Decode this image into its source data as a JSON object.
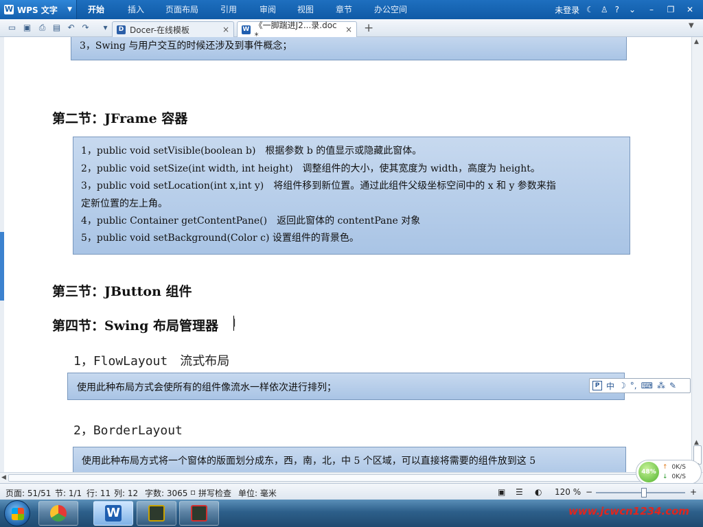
{
  "app": {
    "name": "WPS 文字",
    "menu": [
      "开始",
      "插入",
      "页面布局",
      "引用",
      "审阅",
      "视图",
      "章节",
      "办公空间"
    ],
    "login": "未登录",
    "help": "?"
  },
  "tabs": [
    {
      "label": "Docer-在线模板",
      "icon": "docer-icon",
      "close": "×"
    },
    {
      "label": "《一脚踹进J2...录.doc *",
      "icon": "wps-doc-icon",
      "close": "×"
    }
  ],
  "document": {
    "top_box_line": "3，Swing 与用户交互的时候还涉及到事件概念；",
    "section2": {
      "heading": "第二节：JFrame 容器",
      "items": [
        "1，public void setVisible(boolean b)　根据参数 b 的值显示或隐藏此窗体。",
        "2，public void setSize(int width, int height)　调整组件的大小，使其宽度为 width，高度为 height。",
        "3，public void setLocation(int x,int y)　将组件移到新位置。通过此组件父级坐标空间中的 x 和 y 参数来指",
        "定新位置的左上角。",
        "4，public Container getContentPane()　返回此窗体的 contentPane 对象",
        "5，public void setBackground(Color c) 设置组件的背景色。"
      ]
    },
    "section3": {
      "heading": "第三节：JButton 组件"
    },
    "section4": {
      "heading": "第四节：Swing 布局管理器",
      "layout1": {
        "title": "1，FlowLayout　流式布局",
        "desc": "使用此种布局方式会使所有的组件像流水一样依次进行排列；"
      },
      "layout2": {
        "title": "2，BorderLayout",
        "desc": "使用此种布局方式将一个窗体的版面划分成东，西，南，北，中 5 个区域，可以直接将需要的组件放到这 5"
      }
    }
  },
  "ime_toolbar": {
    "lang": "中"
  },
  "net_widget": {
    "percent": "48%",
    "up": "0K/S",
    "down": "0K/S"
  },
  "status": {
    "page": "页面: 51/51",
    "section": "节: 1/1",
    "row": "行: 11",
    "col": "列: 12",
    "words": "字数: 3065",
    "spell": "拼写检查",
    "unit": "单位: 毫米",
    "zoom": "120 %"
  },
  "watermark": "www.jcwcn1234.com",
  "colors": {
    "accent": "#1460ae",
    "box_fill": "#b8cfeb",
    "watermark": "#e0261e"
  }
}
